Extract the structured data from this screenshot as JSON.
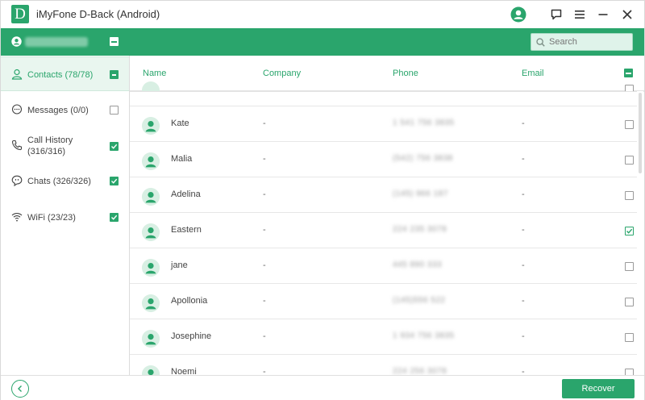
{
  "app": {
    "title": "iMyFone D-Back (Android)",
    "logo_letter": "D",
    "accent_color": "#2aa56c"
  },
  "search": {
    "placeholder": "Search"
  },
  "sidebar": {
    "items": [
      {
        "label": "Contacts (78/78)",
        "icon": "person-icon",
        "state": "partial",
        "active": true
      },
      {
        "label": "Messages (0/0)",
        "icon": "message-icon",
        "state": "unchecked",
        "active": false
      },
      {
        "label": "Call History",
        "label2": "(316/316)",
        "icon": "phone-icon",
        "state": "checked",
        "active": false
      },
      {
        "label": "Chats  (326/326)",
        "icon": "chat-icon",
        "state": "checked",
        "active": false
      },
      {
        "label": "WiFi (23/23)",
        "icon": "wifi-icon",
        "state": "checked",
        "active": false
      }
    ]
  },
  "table": {
    "headers": [
      "Name",
      "Company",
      "Phone",
      "Email"
    ],
    "rows": [
      {
        "name": "Kate",
        "company": "-",
        "phone": "1 541 756 3835",
        "email": "-",
        "checked": false
      },
      {
        "name": "Malia",
        "company": "-",
        "phone": "(542) 756 3838",
        "email": "-",
        "checked": false
      },
      {
        "name": "Adelina",
        "company": "-",
        "phone": "(145) 966 187",
        "email": "-",
        "checked": false
      },
      {
        "name": "Eastern",
        "company": "-",
        "phone": "224 235 3078",
        "email": "-",
        "checked": true
      },
      {
        "name": "jane",
        "company": "-",
        "phone": "445 890 333",
        "email": "-",
        "checked": false
      },
      {
        "name": "Apollonia",
        "company": "-",
        "phone": "(145)556 522",
        "email": "-",
        "checked": false
      },
      {
        "name": "Josephine",
        "company": "-",
        "phone": "1 934 756 3835",
        "email": "-",
        "checked": false
      },
      {
        "name": "Noemi",
        "company": "-",
        "phone": "224 256 3078",
        "email": "-",
        "checked": false
      }
    ]
  },
  "footer": {
    "recover_label": "Recover"
  }
}
